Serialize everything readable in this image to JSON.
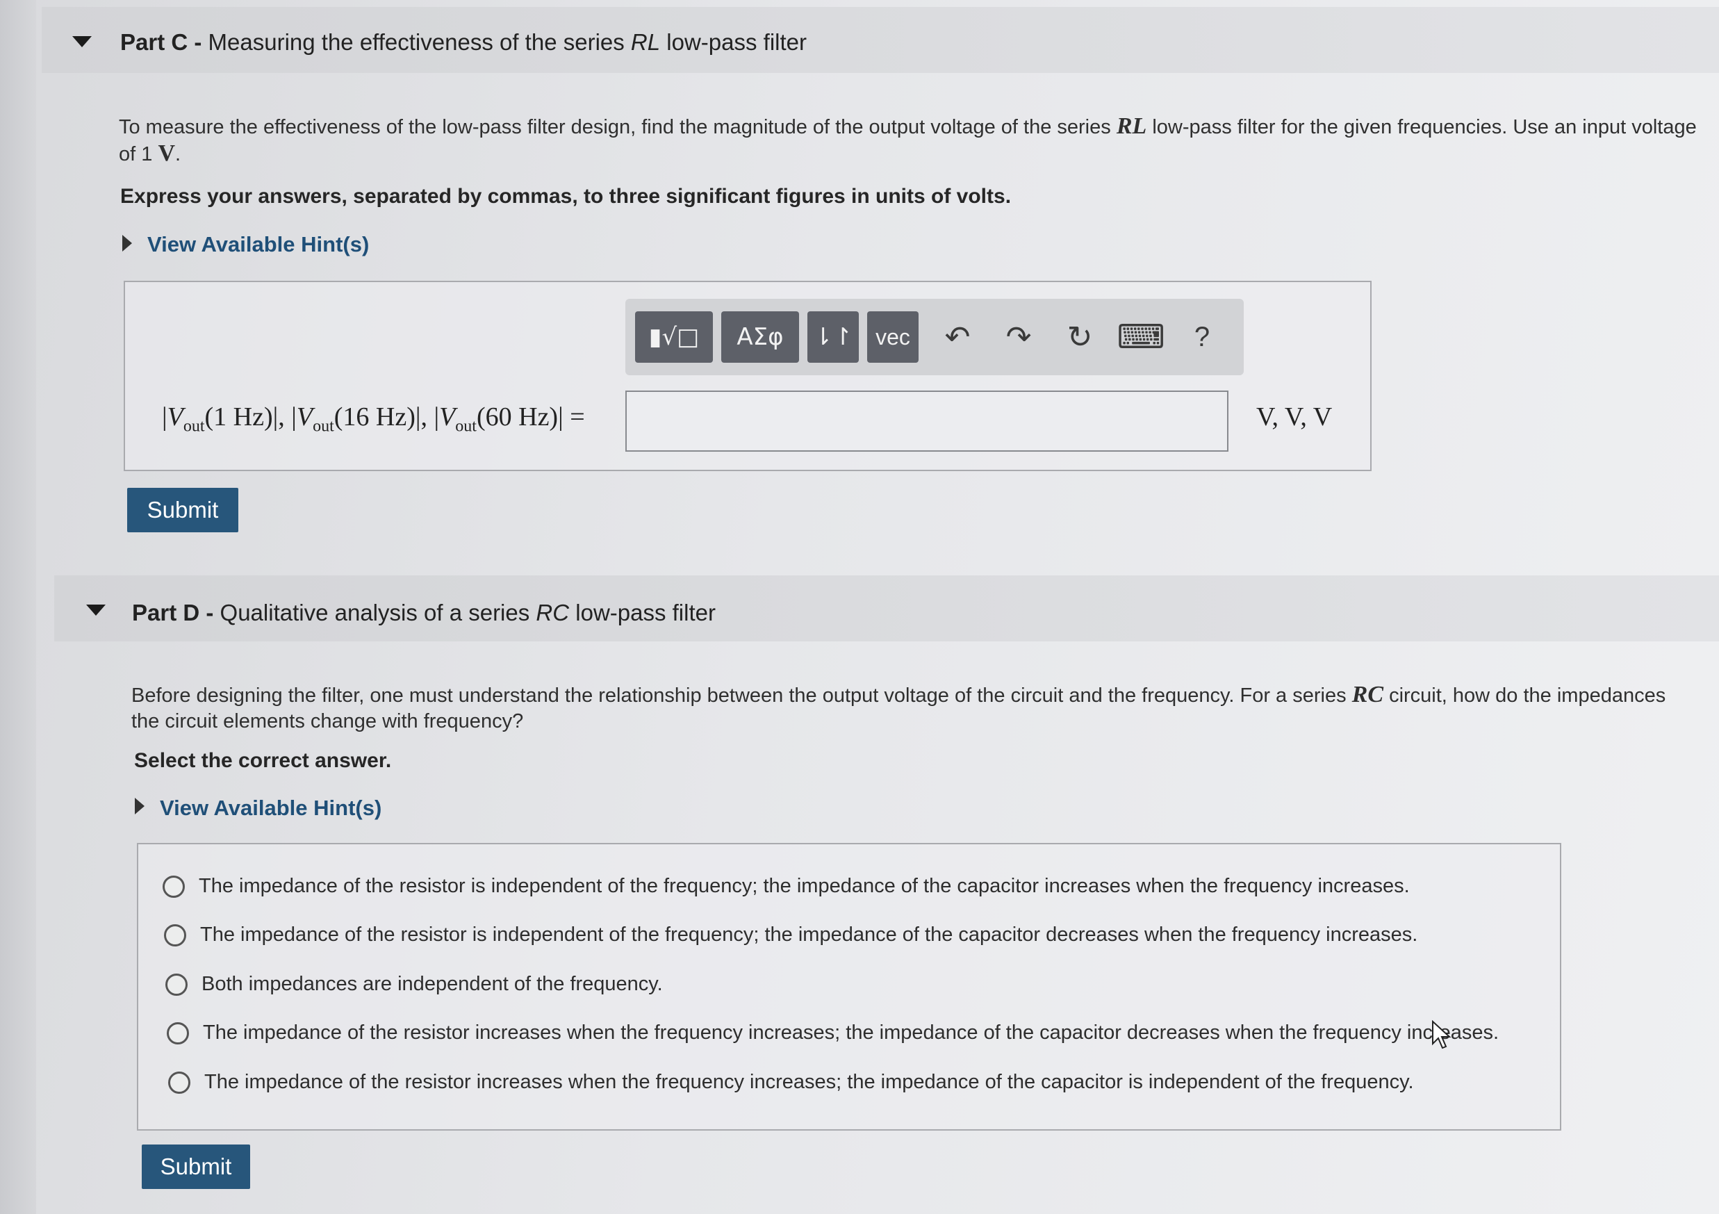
{
  "partC": {
    "label": "Part C",
    "separator": " - ",
    "title_pre": "Measuring the effectiveness of the series ",
    "title_em": "RL",
    "title_post": " low-pass filter",
    "description_pre": "To measure the effectiveness of the low-pass filter design, find the magnitude of the output voltage of the series ",
    "description_math": "RL",
    "description_post": " low-pass filter for the given frequencies. Use an input voltage of 1 ",
    "description_unit": "V",
    "description_end": ".",
    "instruction": "Express your answers, separated by commas, to three significant figures in units of volts.",
    "hint_label": "View Available Hint(s)",
    "toolbar": {
      "templates_label": "▮√□",
      "greek_label": "ΑΣφ",
      "arrows_label": "⇂↾",
      "vec_label": "vec",
      "undo_icon": "↶",
      "redo_icon": "↷",
      "reset_icon": "↻",
      "keyboard_icon": "⌨",
      "help_label": "?"
    },
    "equation": {
      "v": "V",
      "out": "out",
      "f1": "(1 Hz)",
      "f2": "(16 Hz)",
      "f3": "(60 Hz)",
      "bar": "|",
      "sep": ", ",
      "equals": " ="
    },
    "answer_value": "",
    "units": "V, V, V",
    "submit_label": "Submit"
  },
  "partD": {
    "label": "Part D",
    "separator": " - ",
    "title_pre": "Qualitative analysis of a series ",
    "title_em": "RC",
    "title_post": " low-pass filter",
    "description_pre": "Before designing the filter, one must understand the relationship between the output voltage of the circuit and the frequency. For a series ",
    "description_math": "RC",
    "description_post": " circuit, how do the impedances",
    "description_line2": "the circuit elements change with frequency?",
    "instruction": "Select the correct answer.",
    "hint_label": "View Available Hint(s)",
    "options": [
      "The impedance of the resistor is independent of the frequency; the impedance of the capacitor increases when the frequency increases.",
      "The impedance of the resistor is independent of the frequency; the impedance of the capacitor decreases when the frequency increases.",
      "Both impedances are independent of the frequency.",
      "The impedance of the resistor increases when the frequency increases; the impedance of the capacitor decreases when the frequency increases.",
      "The impedance of the resistor increases when the frequency increases; the impedance of the capacitor is independent of the frequency."
    ],
    "submit_label": "Submit"
  }
}
